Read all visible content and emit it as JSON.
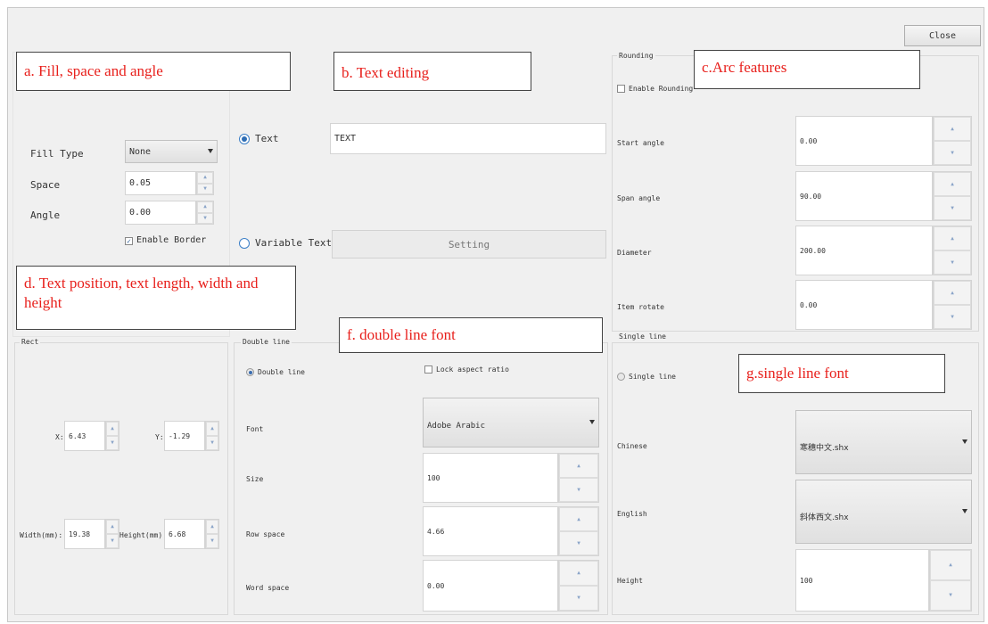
{
  "dialog": {
    "close_label": "Close"
  },
  "callouts": {
    "a": "a. Fill, space and angle",
    "b": "b. Text editing",
    "c": "c.Arc features",
    "d": "d. Text position, text length, width and height",
    "f": "f. double line font",
    "g": "g.single line font"
  },
  "fill": {
    "fill_type_label": "Fill Type",
    "fill_type_value": "None",
    "space_label": "Space",
    "space_value": "0.05",
    "angle_label": "Angle",
    "angle_value": "0.00",
    "enable_border_label": "Enable Border",
    "enable_border_checked": true
  },
  "text_edit": {
    "text_radio_label": "Text",
    "text_value": "TEXT",
    "variable_text_label": "Variable Text",
    "setting_label": "Setting"
  },
  "rounding": {
    "group_title": "Rounding",
    "enable_rounding_label": "Enable Rounding",
    "rows": [
      {
        "label": "Start angle",
        "value": "0.00"
      },
      {
        "label": "Span angle",
        "value": "90.00"
      },
      {
        "label": "Diameter",
        "value": "200.00"
      },
      {
        "label": "Item rotate",
        "value": "0.00"
      }
    ]
  },
  "rect": {
    "group_title": "Rect",
    "x_label": "X:",
    "x_value": "6.43",
    "y_label": "Y:",
    "y_value": "-1.29",
    "width_label": "Width(mm):",
    "width_value": "19.38",
    "height_label": "Height(mm):",
    "height_value": "6.68"
  },
  "double_line": {
    "group_title": "Double line",
    "radio_label": "Double line",
    "lock_label": "Lock aspect ratio",
    "font_label": "Font",
    "font_value": "Adobe Arabic",
    "size_label": "Size",
    "size_value": "100",
    "row_space_label": "Row space",
    "row_space_value": "4.66",
    "word_space_label": "Word space",
    "word_space_value": "0.00"
  },
  "single_line": {
    "group_title": "Single line",
    "radio_label": "Single line",
    "chinese_label": "Chinese",
    "chinese_value": "寒穗中文.shx",
    "english_label": "English",
    "english_value": "斜体西文.shx",
    "height_label": "Height",
    "height_value": "100"
  },
  "icons": {
    "spin_up": "spin-up-icon",
    "spin_down": "spin-down-icon",
    "dropdown": "chevron-down-icon"
  }
}
